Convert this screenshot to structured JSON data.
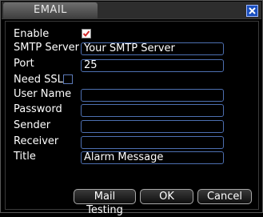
{
  "window": {
    "title": "EMAIL"
  },
  "icons": {
    "close": "close-icon",
    "check": "checkmark-icon"
  },
  "colors": {
    "field_border": "#4d6fb0",
    "close_bg": "#1a4fbf",
    "checkmark": "#d22b2b"
  },
  "form": {
    "enable": {
      "label": "Enable",
      "checked": true
    },
    "smtp_server": {
      "label": "SMTP Server",
      "value": "Your SMTP Server"
    },
    "port": {
      "label": "Port",
      "value": "25"
    },
    "need_ssl": {
      "label": "Need SSL",
      "checked": false
    },
    "user_name": {
      "label": "User Name",
      "value": ""
    },
    "password": {
      "label": "Password",
      "value": ""
    },
    "sender": {
      "label": "Sender",
      "value": ""
    },
    "receiver": {
      "label": "Receiver",
      "value": ""
    },
    "title": {
      "label": "Title",
      "value": "Alarm Message"
    }
  },
  "buttons": {
    "mail_testing": "Mail Testing",
    "ok": "OK",
    "cancel": "Cancel"
  }
}
